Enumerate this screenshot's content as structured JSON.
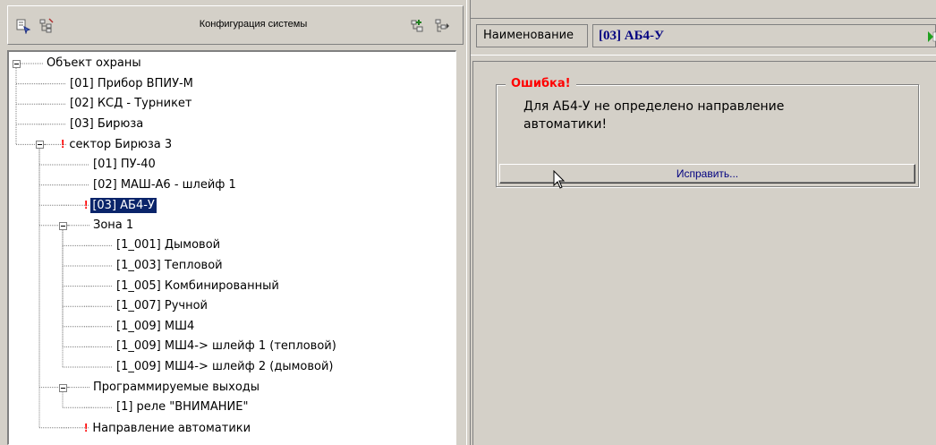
{
  "left_panel": {
    "title": "Конфигурация системы",
    "toolbar_icons": [
      "properties-icon",
      "tree-settings-icon",
      "add-device-icon",
      "expand-icon"
    ]
  },
  "tree": [
    {
      "label": "Объект охраны",
      "level": 0,
      "expanded": true,
      "mark": false,
      "selected": false
    },
    {
      "label": "[01] Прибор ВПИУ-М",
      "level": 1,
      "mark": false,
      "selected": false
    },
    {
      "label": "[02] КСД - Турникет",
      "level": 1,
      "mark": false,
      "selected": false
    },
    {
      "label": "[03] Бирюза",
      "level": 1,
      "mark": false,
      "selected": false
    },
    {
      "label": "сектор Бирюза 3",
      "level": 1,
      "expanded": true,
      "mark": true,
      "selected": false
    },
    {
      "label": "[01] ПУ-40",
      "level": 2,
      "mark": false,
      "selected": false
    },
    {
      "label": "[02] МАШ-А6 - шлейф 1",
      "level": 2,
      "mark": false,
      "selected": false
    },
    {
      "label": "[03] АБ4-У",
      "level": 2,
      "mark": true,
      "selected": true
    },
    {
      "label": "Зона 1",
      "level": 2,
      "expanded": true,
      "mark": false,
      "selected": false
    },
    {
      "label": "[1_001] Дымовой",
      "level": 3,
      "mark": false,
      "selected": false
    },
    {
      "label": "[1_003] Тепловой",
      "level": 3,
      "mark": false,
      "selected": false
    },
    {
      "label": "[1_005] Комбинированный",
      "level": 3,
      "mark": false,
      "selected": false
    },
    {
      "label": "[1_007] Ручной",
      "level": 3,
      "mark": false,
      "selected": false
    },
    {
      "label": "[1_009] МШ4",
      "level": 3,
      "mark": false,
      "selected": false
    },
    {
      "label": "[1_009] МШ4-> шлейф 1 (тепловой)",
      "level": 3,
      "mark": false,
      "selected": false
    },
    {
      "label": "[1_009] МШ4-> шлейф 2 (дымовой)",
      "level": 3,
      "mark": false,
      "selected": false
    },
    {
      "label": "Программируемые выходы",
      "level": 2,
      "expanded": true,
      "mark": false,
      "selected": false
    },
    {
      "label": "[1] реле \"ВНИМАНИЕ\"",
      "level": 3,
      "mark": false,
      "selected": false
    },
    {
      "label": "Направление автоматики",
      "level": 2,
      "mark": true,
      "selected": false
    }
  ],
  "right_panel": {
    "name_label": "Наименование",
    "name_value": "[03] АБ4-У",
    "error": {
      "title": "Ошибка!",
      "message": "Для АБ4-У не определено направление автоматики!",
      "fix_label": "Исправить..."
    }
  },
  "colors": {
    "window_bg": "#d4d0c8",
    "selection": "#0a246a",
    "error": "#ff0000",
    "link": "#000080"
  }
}
